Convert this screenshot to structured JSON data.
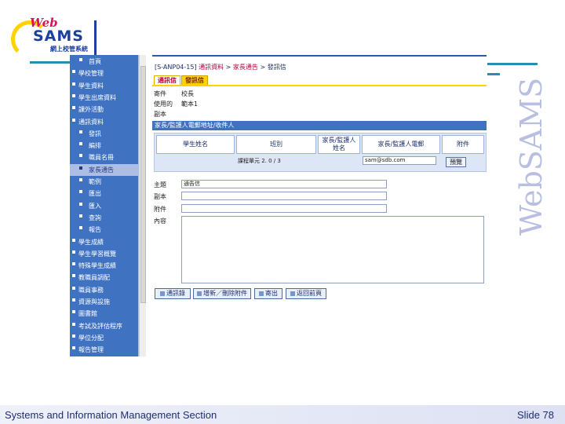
{
  "logo": {
    "web": "Web",
    "sams": "SAMS",
    "cn": "網上校管系統"
  },
  "nav": {
    "items": [
      {
        "label": "首頁",
        "level": 1
      },
      {
        "label": "學校管理",
        "level": 0
      },
      {
        "label": "學生資料",
        "level": 0
      },
      {
        "label": "學生出席資料",
        "level": 0
      },
      {
        "label": "課外活動",
        "level": 0
      },
      {
        "label": "通訊資料",
        "level": 0
      },
      {
        "label": "發訊",
        "level": 1
      },
      {
        "label": "編排",
        "level": 1
      },
      {
        "label": "職員名冊",
        "level": 1
      },
      {
        "label": "家長通告",
        "level": 1,
        "selected": true
      },
      {
        "label": "範例",
        "level": 1
      },
      {
        "label": "匯出",
        "level": 1
      },
      {
        "label": "匯入",
        "level": 1
      },
      {
        "label": "查詢",
        "level": 1
      },
      {
        "label": "報告",
        "level": 1
      },
      {
        "label": "學生成績",
        "level": 0
      },
      {
        "label": "學生學習概覽",
        "level": 0
      },
      {
        "label": "特殊學生成績",
        "level": 0
      },
      {
        "label": "教職員調配",
        "level": 0
      },
      {
        "label": "職員事務",
        "level": 0
      },
      {
        "label": "資源與設施",
        "level": 0
      },
      {
        "label": "圖書館",
        "level": 0
      },
      {
        "label": "考試及評估程序",
        "level": 0
      },
      {
        "label": "學位分配",
        "level": 0
      },
      {
        "label": "報告管理",
        "level": 0
      }
    ]
  },
  "breadcrumb": {
    "code": "[S-ANP04-15]",
    "path1": "通訊資料",
    "sep": " > ",
    "path2": "家長通告",
    "path3": "發訊信"
  },
  "tabs": {
    "tab1": "通訊信",
    "tab2": "發訊信"
  },
  "fields": {
    "sender_label": "寄件",
    "sender_value": "校長",
    "template_label": "使用的",
    "template_value": "範本1",
    "status_label": "副本",
    "status_value": ""
  },
  "recipients_bar": "家長/監護人電郵地址/收件人",
  "table": {
    "headers": [
      "學生姓名",
      "班別",
      "家長/監護人\n姓名",
      "家長/監護人電郵",
      "附件"
    ],
    "row": {
      "student": "",
      "class": "課程單元 2. 0 / 3",
      "guardian": "",
      "email": "sam@sdb.com",
      "preview": "預覽"
    }
  },
  "form": {
    "subject_label": "主題",
    "subject_value": "通告信",
    "cc_label": "副本",
    "attach_label": "附件",
    "body_label": "內容"
  },
  "buttons": {
    "address_book": "通訊錄",
    "add_remove": "增新／刪除附件",
    "send": "寄出",
    "back": "返回前頁"
  },
  "watermark": "WebSAMS",
  "footer": {
    "left": "Systems and Information Management Section",
    "right": "Slide 78"
  },
  "colors": {
    "nav_bg": "#3f72c1",
    "accent": "#ffd200",
    "brand": "#1b3f9a",
    "link": "#b4003c"
  }
}
